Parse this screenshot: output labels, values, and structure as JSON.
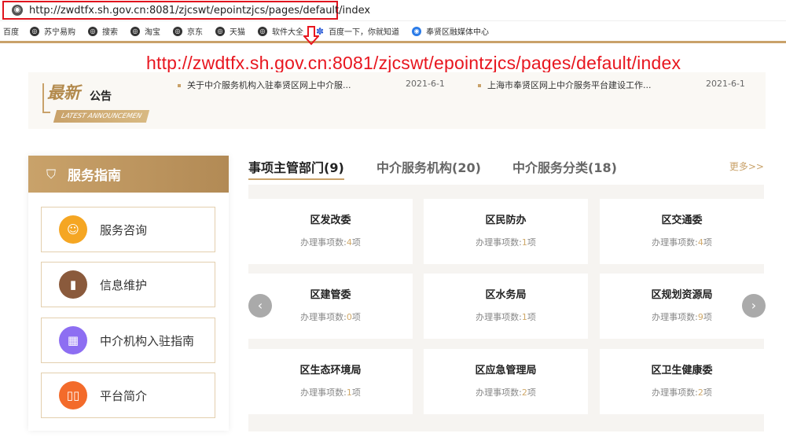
{
  "browser": {
    "url": "http://zwdtfx.sh.gov.cn:8081/zjcswt/epointzjcs/pages/default/index"
  },
  "bookmarks": [
    {
      "label": "百度",
      "icon": "none"
    },
    {
      "label": "苏宁易购",
      "icon": "globe-icon"
    },
    {
      "label": "搜索",
      "icon": "globe-icon"
    },
    {
      "label": "淘宝",
      "icon": "globe-icon"
    },
    {
      "label": "京东",
      "icon": "globe-icon"
    },
    {
      "label": "天猫",
      "icon": "globe-icon"
    },
    {
      "label": "软件大全",
      "icon": "globe-icon"
    },
    {
      "label": "百度一下，你就知道",
      "icon": "paw-icon"
    },
    {
      "label": "奉贤区融媒体中心",
      "icon": "media-icon"
    }
  ],
  "annotation": {
    "url": "http://zwdtfx.sh.gov.cn:8081/zjcswt/epointzjcs/pages/default/index"
  },
  "announcement": {
    "logo_big": "最新",
    "logo_small": "公告",
    "logo_tag": "LATEST ANNOUNCEMEN",
    "items": [
      {
        "title": "关于中介服务机构入驻奉贤区网上中介服...",
        "date": "2021-6-1"
      },
      {
        "title": "上海市奉贤区网上中介服务平台建设工作...",
        "date": "2021-6-1"
      }
    ]
  },
  "sidebar": {
    "title": "服务指南",
    "items": [
      {
        "label": "服务咨询",
        "icon": "headset-icon",
        "color": "#f5a623"
      },
      {
        "label": "信息维护",
        "icon": "book-icon",
        "color": "#8a5a3c"
      },
      {
        "label": "中介机构入驻指南",
        "icon": "building-icon",
        "color": "#8d6ef2"
      },
      {
        "label": "平台简介",
        "icon": "book-open-icon",
        "color": "#f36b2b"
      }
    ]
  },
  "tabs": [
    {
      "label": "事项主管部门(9)",
      "active": true
    },
    {
      "label": "中介服务机构(20)",
      "active": false
    },
    {
      "label": "中介服务分类(18)",
      "active": false
    }
  ],
  "more_label": "更多>>",
  "count_prefix": "办理事项数:",
  "count_suffix": "项",
  "departments": [
    {
      "name": "区发改委",
      "count": "4"
    },
    {
      "name": "区民防办",
      "count": "1"
    },
    {
      "name": "区交通委",
      "count": "4"
    },
    {
      "name": "区建管委",
      "count": "0"
    },
    {
      "name": "区水务局",
      "count": "1"
    },
    {
      "name": "区规划资源局",
      "count": "9"
    },
    {
      "name": "区生态环境局",
      "count": "1"
    },
    {
      "name": "区应急管理局",
      "count": "2"
    },
    {
      "name": "区卫生健康委",
      "count": "2"
    }
  ],
  "colors": {
    "accent": "#c9a26a",
    "annotation_red": "#e8161f"
  }
}
